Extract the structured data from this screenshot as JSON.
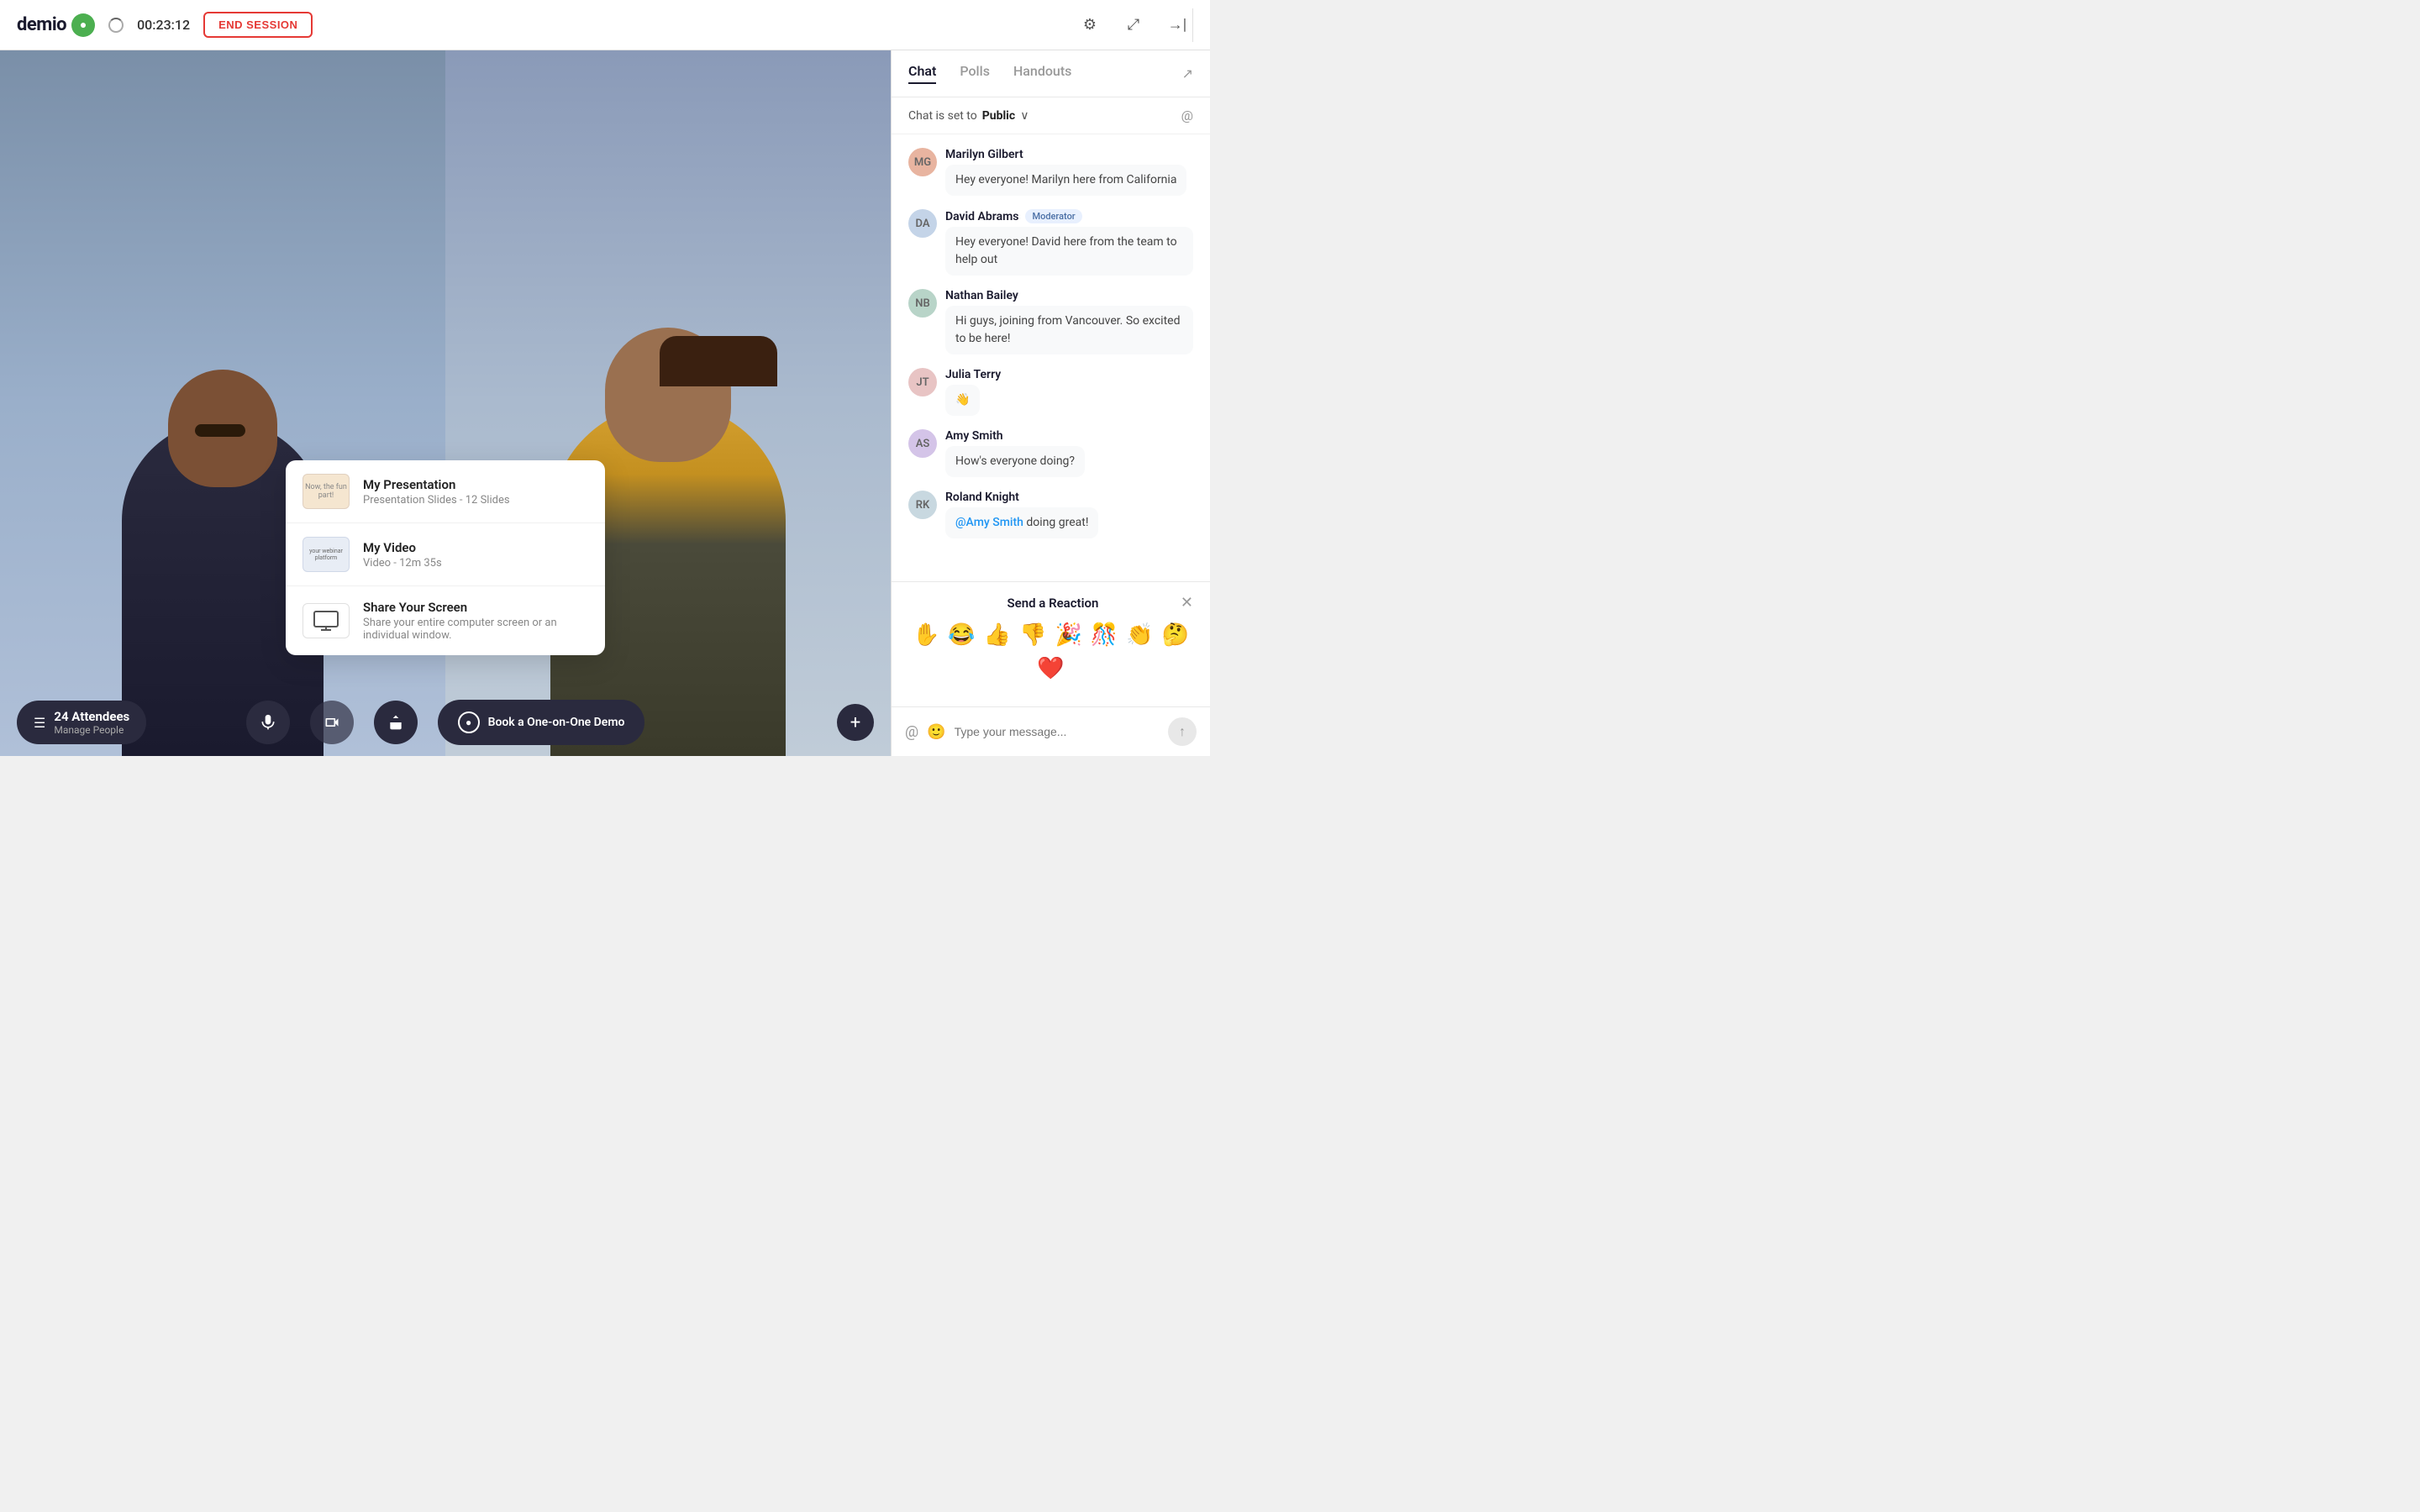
{
  "header": {
    "logo_text": "demio",
    "timer": "00:23:12",
    "end_session_label": "END SESSION"
  },
  "tabs": {
    "chat_label": "Chat",
    "polls_label": "Polls",
    "handouts_label": "Handouts"
  },
  "chat": {
    "public_status": "Chat is set to",
    "public_label": "Public",
    "messages": [
      {
        "sender": "Marilyn Gilbert",
        "moderator": false,
        "text": "Hey everyone! Marilyn here from California",
        "avatar_initials": "MG",
        "avatar_class": "avatar-1"
      },
      {
        "sender": "David Abrams",
        "moderator": true,
        "text": "Hey everyone! David here from the team to help out",
        "avatar_initials": "DA",
        "avatar_class": "avatar-2"
      },
      {
        "sender": "Nathan Bailey",
        "moderator": false,
        "text": "Hi guys, joining from Vancouver. So excited to be here!",
        "avatar_initials": "NB",
        "avatar_class": "avatar-3"
      },
      {
        "sender": "Julia Terry",
        "moderator": false,
        "text": "👋",
        "avatar_initials": "JT",
        "avatar_class": "avatar-4"
      },
      {
        "sender": "Amy Smith",
        "moderator": false,
        "text": "How's everyone doing?",
        "avatar_initials": "AS",
        "avatar_class": "avatar-5"
      },
      {
        "sender": "Roland Knight",
        "moderator": false,
        "text_before": "",
        "mention": "@Amy Smith",
        "text_after": " doing great!",
        "avatar_initials": "RK",
        "avatar_class": "avatar-6"
      }
    ],
    "moderator_badge": "Moderator"
  },
  "reaction": {
    "title": "Send a Reaction",
    "emojis": [
      "✋",
      "😂",
      "👍",
      "👎",
      "🎉",
      "🎊",
      "👏",
      "🤔",
      "❤️"
    ]
  },
  "input": {
    "placeholder": "Type your message..."
  },
  "presentation": {
    "item1_title": "My Presentation",
    "item1_subtitle": "Presentation Slides - 12 Slides",
    "item1_thumb": "Now, the fun part!",
    "item2_title": "My Video",
    "item2_subtitle": "Video - 12m 35s",
    "item2_thumb": "your webinar platform",
    "item3_title": "Share Your Screen",
    "item3_subtitle": "Share your entire computer screen or an individual window."
  },
  "toolbar": {
    "attendees_count": "24 Attendees",
    "attendees_manage": "Manage People",
    "book_demo": "Book a One-on-One Demo"
  }
}
